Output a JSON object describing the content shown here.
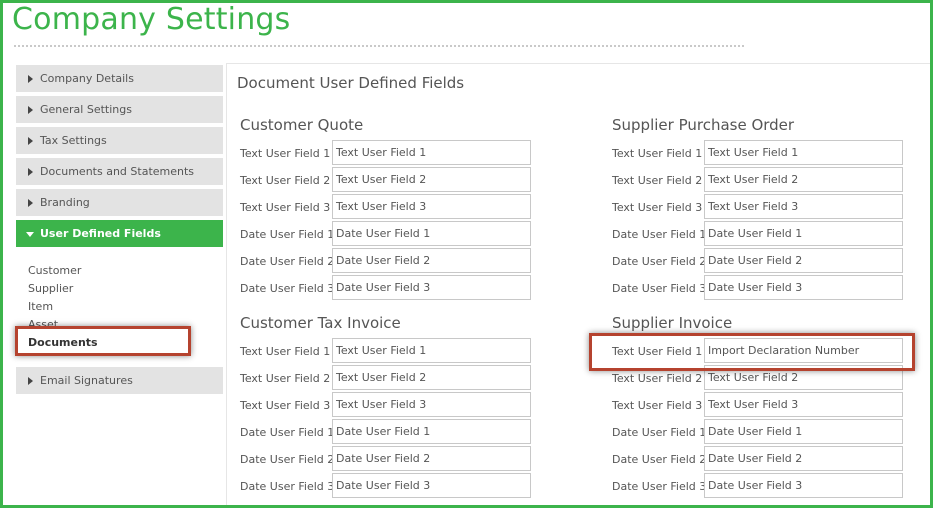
{
  "app_title": "Company Settings",
  "sidebar": {
    "items": [
      {
        "label": "Company Details"
      },
      {
        "label": "General Settings"
      },
      {
        "label": "Tax Settings"
      },
      {
        "label": "Documents and Statements"
      },
      {
        "label": "Branding"
      },
      {
        "label": "User Defined Fields"
      },
      {
        "label": "Email Signatures"
      }
    ],
    "subitems": [
      {
        "label": "Customer"
      },
      {
        "label": "Supplier"
      },
      {
        "label": "Item"
      },
      {
        "label": "Asset"
      },
      {
        "label": "Documents"
      }
    ],
    "active_item": "User Defined Fields",
    "selected_subitem": "Documents"
  },
  "main": {
    "title": "Document User Defined Fields",
    "sections": [
      {
        "title": "Customer Quote",
        "fields": [
          {
            "label": "Text User Field 1",
            "value": "Text User Field 1"
          },
          {
            "label": "Text User Field 2",
            "value": "Text User Field 2"
          },
          {
            "label": "Text User Field 3",
            "value": "Text User Field 3"
          },
          {
            "label": "Date User Field 1",
            "value": "Date User Field 1"
          },
          {
            "label": "Date User Field 2",
            "value": "Date User Field 2"
          },
          {
            "label": "Date User Field 3",
            "value": "Date User Field 3"
          }
        ]
      },
      {
        "title": "Supplier Purchase Order",
        "fields": [
          {
            "label": "Text User Field 1",
            "value": "Text User Field 1"
          },
          {
            "label": "Text User Field 2",
            "value": "Text User Field 2"
          },
          {
            "label": "Text User Field 3",
            "value": "Text User Field 3"
          },
          {
            "label": "Date User Field 1",
            "value": "Date User Field 1"
          },
          {
            "label": "Date User Field 2",
            "value": "Date User Field 2"
          },
          {
            "label": "Date User Field 3",
            "value": "Date User Field 3"
          }
        ]
      },
      {
        "title": "Customer Tax Invoice",
        "fields": [
          {
            "label": "Text User Field 1",
            "value": "Text User Field 1"
          },
          {
            "label": "Text User Field 2",
            "value": "Text User Field 2"
          },
          {
            "label": "Text User Field 3",
            "value": "Text User Field 3"
          },
          {
            "label": "Date User Field 1",
            "value": "Date User Field 1"
          },
          {
            "label": "Date User Field 2",
            "value": "Date User Field 2"
          },
          {
            "label": "Date User Field 3",
            "value": "Date User Field 3"
          }
        ]
      },
      {
        "title": "Supplier Invoice",
        "fields": [
          {
            "label": "Text User Field 1",
            "value": "Import Declaration Number"
          },
          {
            "label": "Text User Field 2",
            "value": "Text User Field 2"
          },
          {
            "label": "Text User Field 3",
            "value": "Text User Field 3"
          },
          {
            "label": "Date User Field 1",
            "value": "Date User Field 1"
          },
          {
            "label": "Date User Field 2",
            "value": "Date User Field 2"
          },
          {
            "label": "Date User Field 3",
            "value": "Date User Field 3"
          }
        ]
      }
    ]
  },
  "colors": {
    "brand_green": "#3cb44b",
    "highlight_red": "#b5432f",
    "sidebar_bg": "#e3e3e3"
  }
}
